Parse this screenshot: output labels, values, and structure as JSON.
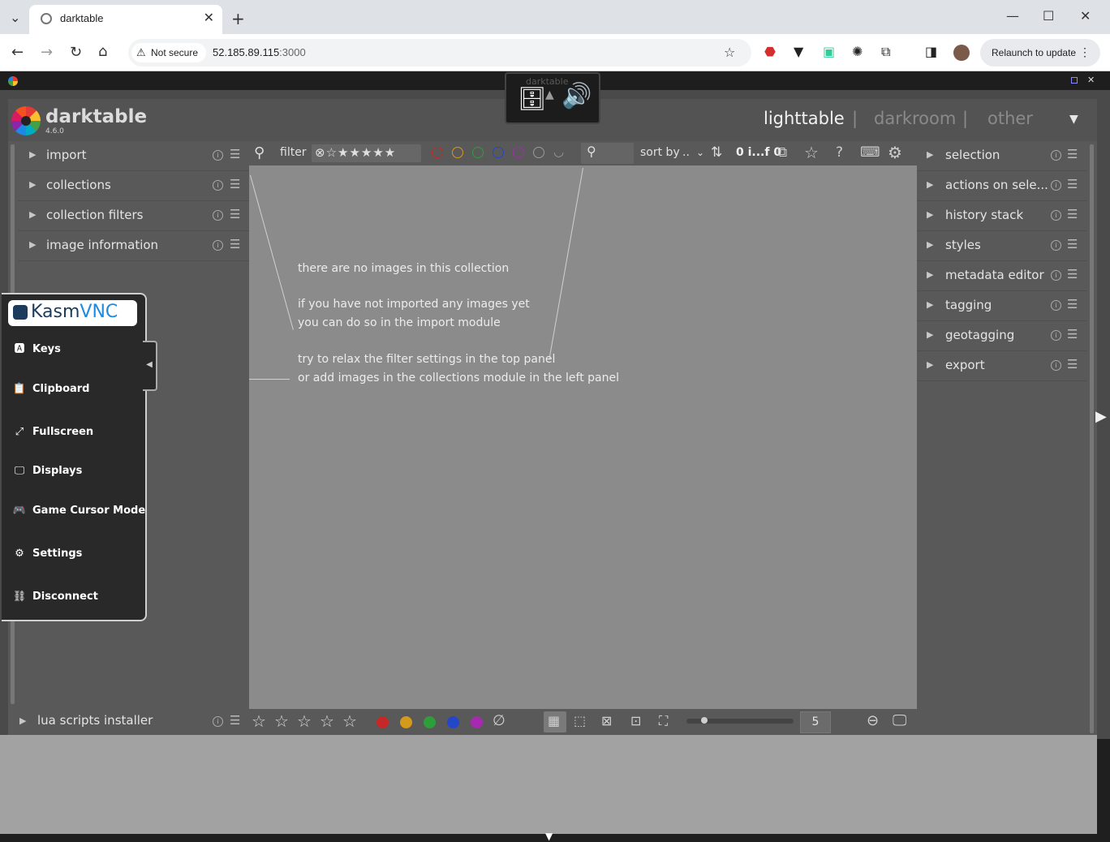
{
  "browser": {
    "tab_title": "darktable",
    "not_secure": "Not secure",
    "url_host": "52.185.89.115",
    "url_port": ":3000",
    "relaunch": "Relaunch to update"
  },
  "darktable": {
    "app_name": "darktable",
    "version": "4.6.0",
    "views": [
      "lighttable",
      "darkroom",
      "other"
    ],
    "separator": "|",
    "left_modules": [
      "import",
      "collections",
      "collection filters",
      "image information"
    ],
    "bottom_left_module": "lua scripts installer",
    "right_modules": [
      "selection",
      "actions on sele...",
      "history stack",
      "styles",
      "metadata editor",
      "tagging",
      "geotagging",
      "export"
    ],
    "top_bar": {
      "filter_label": "filter",
      "sort_label": "sort by",
      "sort_value": "..",
      "count_text": "0 i...f 0"
    },
    "empty_message": {
      "line1": "there are no images in this collection",
      "line2": "if you have not imported any images yet",
      "line3": "you can do so in the import module",
      "line4": "try to relax the filter settings in the top panel",
      "line5": "or add images in the collections module in the left panel"
    },
    "zoom_value": "5",
    "label_colors": [
      "#c62828",
      "#d39a1b",
      "#2e9e3a",
      "#2347c8",
      "#a62ab0"
    ]
  },
  "kasm": {
    "toast_label": "darktable",
    "logo_kasm": "Kasm",
    "logo_vnc": "VNC",
    "menu": [
      "Keys",
      "Clipboard",
      "Fullscreen",
      "Displays",
      "Game Cursor Mode",
      "Settings",
      "Disconnect"
    ]
  }
}
